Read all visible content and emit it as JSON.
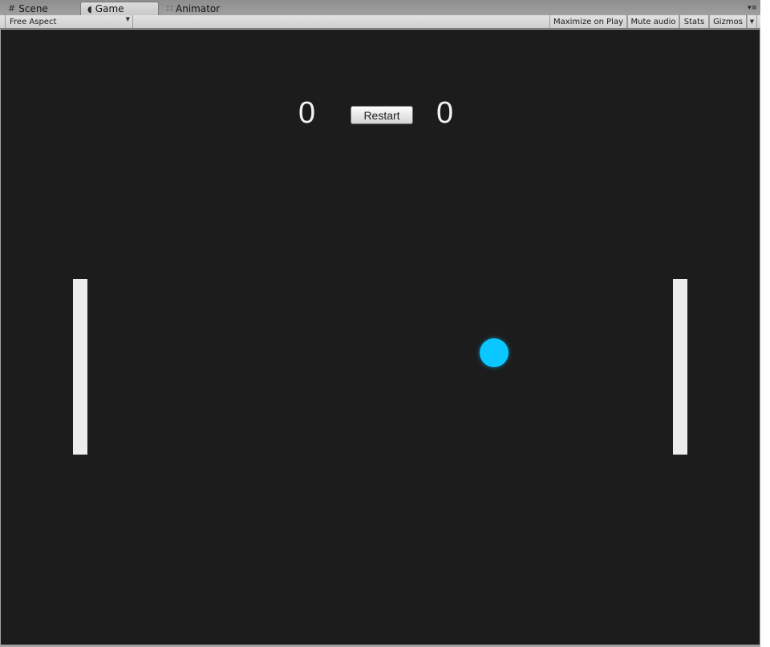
{
  "tabs": [
    {
      "label": "Scene",
      "icon": "grid-icon",
      "active": false
    },
    {
      "label": "Game",
      "icon": "pacman-icon",
      "active": true
    },
    {
      "label": "Animator",
      "icon": "animator-nodes-icon",
      "active": false
    }
  ],
  "toolbar": {
    "aspect_label": "Free Aspect",
    "maximize_label": "Maximize on Play",
    "mute_label": "Mute audio",
    "stats_label": "Stats",
    "gizmos_label": "Gizmos"
  },
  "game": {
    "score_left": "0",
    "score_right": "0",
    "restart_label": "Restart",
    "ball_color": "#0ac8ff",
    "paddle_color": "#ececec",
    "background_color": "#1c1c1c"
  }
}
